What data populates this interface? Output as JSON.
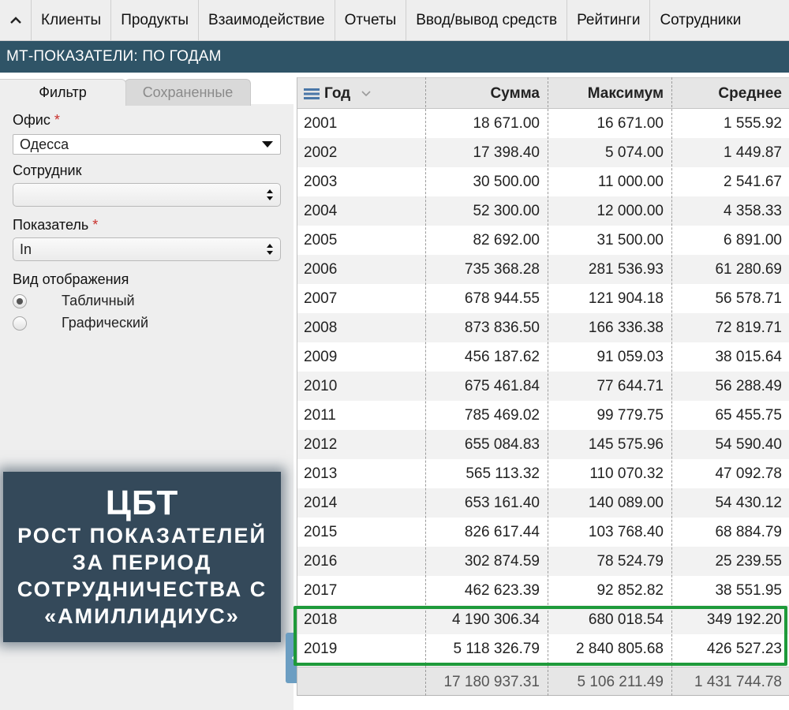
{
  "nav": {
    "items": [
      "Клиенты",
      "Продукты",
      "Взаимодействие",
      "Отчеты",
      "Ввод/вывод средств",
      "Рейтинги",
      "Сотрудники"
    ]
  },
  "title": "МТ-ПОКАЗАТЕЛИ: ПО ГОДАМ",
  "filter": {
    "tabs": {
      "active": "Фильтр",
      "saved": "Сохраненные"
    },
    "office_label": "Офис",
    "office_value": "Одесса",
    "employee_label": "Сотрудник",
    "employee_value": "",
    "indicator_label": "Показатель",
    "indicator_value": "In",
    "required_mark": "*",
    "view_label": "Вид отображения",
    "view_options": [
      "Табличный",
      "Графический"
    ],
    "view_selected": 0
  },
  "banner": {
    "title": "ЦБТ",
    "lines": [
      "РОСТ ПОКАЗАТЕЛЕЙ",
      "ЗА ПЕРИОД",
      "СОТРУДНИЧЕСТВА С",
      "«АМИЛЛИДИУС»"
    ]
  },
  "table": {
    "columns": [
      "Год",
      "Сумма",
      "Максимум",
      "Среднее"
    ],
    "rows": [
      [
        "2001",
        "18 671.00",
        "16 671.00",
        "1 555.92"
      ],
      [
        "2002",
        "17 398.40",
        "5 074.00",
        "1 449.87"
      ],
      [
        "2003",
        "30 500.00",
        "11 000.00",
        "2 541.67"
      ],
      [
        "2004",
        "52 300.00",
        "12 000.00",
        "4 358.33"
      ],
      [
        "2005",
        "82 692.00",
        "31 500.00",
        "6 891.00"
      ],
      [
        "2006",
        "735 368.28",
        "281 536.93",
        "61 280.69"
      ],
      [
        "2007",
        "678 944.55",
        "121 904.18",
        "56 578.71"
      ],
      [
        "2008",
        "873 836.50",
        "166 336.38",
        "72 819.71"
      ],
      [
        "2009",
        "456 187.62",
        "91 059.03",
        "38 015.64"
      ],
      [
        "2010",
        "675 461.84",
        "77 644.71",
        "56 288.49"
      ],
      [
        "2011",
        "785 469.02",
        "99 779.75",
        "65 455.75"
      ],
      [
        "2012",
        "655 084.83",
        "145 575.96",
        "54 590.40"
      ],
      [
        "2013",
        "565 113.32",
        "110 070.32",
        "47 092.78"
      ],
      [
        "2014",
        "653 161.40",
        "140 089.00",
        "54 430.12"
      ],
      [
        "2015",
        "826 617.44",
        "103 768.40",
        "68 884.79"
      ],
      [
        "2016",
        "302 874.59",
        "78 524.79",
        "25 239.55"
      ],
      [
        "2017",
        "462 623.39",
        "92 852.82",
        "38 551.95"
      ],
      [
        "2018",
        "4 190 306.34",
        "680 018.54",
        "349 192.20"
      ],
      [
        "2019",
        "5 118 326.79",
        "2 840 805.68",
        "426 527.23"
      ]
    ],
    "totals": [
      "17 180 937.31",
      "5 106 211.49",
      "1 431 744.78"
    ]
  },
  "colors": {
    "title_bar": "#2f5467",
    "banner": "#34495a",
    "highlight": "#1e9a3a",
    "required": "#c9302c"
  }
}
